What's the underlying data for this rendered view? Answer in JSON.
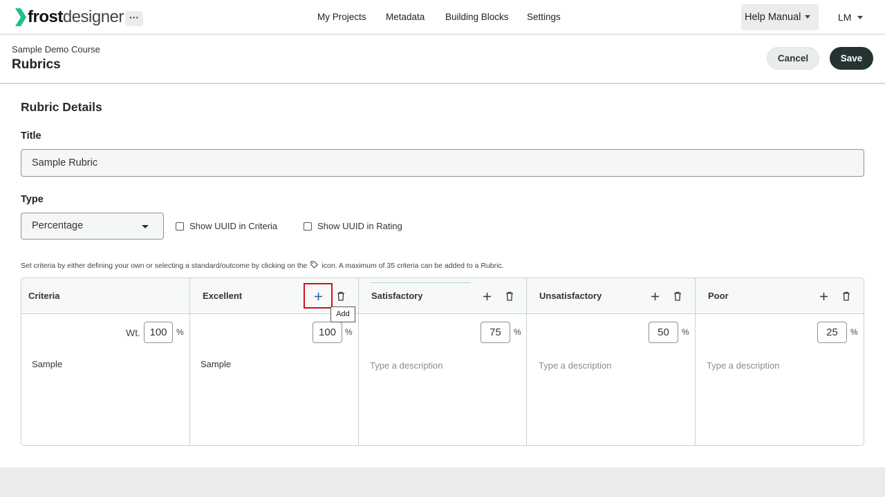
{
  "app": {
    "logo_bold": "frost",
    "logo_light": "designer",
    "more_label": "···",
    "nav": [
      "My Projects",
      "Metadata",
      "Building Blocks",
      "Settings"
    ],
    "help_label": "Help Manual",
    "user_initials": "LM",
    "accent_color": "#233432",
    "logo_color": "#1fbf8f"
  },
  "header": {
    "breadcrumb": "Sample Demo Course",
    "title": "Rubrics",
    "cancel_label": "Cancel",
    "save_label": "Save"
  },
  "form": {
    "section_title": "Rubric Details",
    "title_label": "Title",
    "title_value": "Sample Rubric",
    "type_label": "Type",
    "type_value": "Percentage",
    "show_uuid_criteria": "Show UUID in Criteria",
    "show_uuid_rating": "Show UUID in Rating",
    "instruction_before": "Set criteria by either defining your own or selecting a standard/outcome by clicking on the",
    "instruction_after": "icon. A maximum of 35 criteria can be added to a Rubric."
  },
  "rubric": {
    "criteria_header": "Criteria",
    "weight_label": "Wt.",
    "weight_value": "100",
    "percent_sign": "%",
    "criteria_text": "Sample",
    "add_tooltip": "Add",
    "ratings": [
      {
        "name": "Excellent",
        "value": "100",
        "description": "Sample",
        "placeholder": ""
      },
      {
        "name": "Satisfactory",
        "value": "75",
        "description": "",
        "placeholder": "Type a description"
      },
      {
        "name": "Unsatisfactory",
        "value": "50",
        "description": "",
        "placeholder": "Type a description"
      },
      {
        "name": "Poor",
        "value": "25",
        "description": "",
        "placeholder": "Type a description"
      }
    ]
  }
}
